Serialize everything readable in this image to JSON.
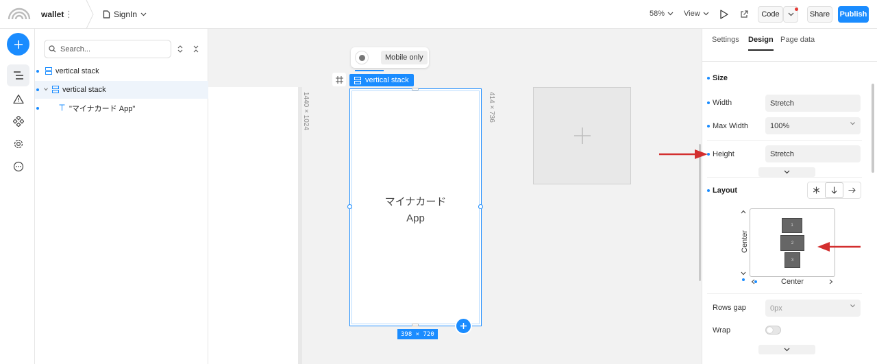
{
  "topbar": {
    "project_name": "wallet",
    "project_menu": "⋮",
    "page_name": "SignIn",
    "zoom": "58%",
    "view_label": "View",
    "code_label": "Code",
    "share_label": "Share",
    "publish_label": "Publish"
  },
  "rail": {
    "items": [
      "add-icon",
      "layers-icon",
      "warning-icon",
      "components-icon",
      "settings-icon",
      "more-icon"
    ]
  },
  "layers_panel": {
    "search_placeholder": "Search...",
    "rows": [
      {
        "label": "vertical stack",
        "type": "stack-icon",
        "selected": false
      },
      {
        "label": "vertical stack",
        "type": "stack-icon",
        "selected": true
      },
      {
        "label": "\"マイナカード App\"",
        "type": "text-icon",
        "selected": false
      }
    ]
  },
  "canvas": {
    "desktop_size": "1440 × 1024",
    "mobile_size": "414 × 736",
    "mobile_only_label": "Mobile only",
    "selection_tag": "vertical stack",
    "phone_text_line1": "マイナカード",
    "phone_text_line2": "App",
    "selection_size": "398 × 720"
  },
  "right_panel": {
    "tabs": [
      "Settings",
      "Design",
      "Page data"
    ],
    "active_tab": "Design",
    "size_section": {
      "title": "Size",
      "width_label": "Width",
      "width_value": "Stretch",
      "max_width_label": "Max Width",
      "max_width_value": "100%",
      "height_label": "Height",
      "height_value": "Stretch"
    },
    "layout_section": {
      "title": "Layout",
      "items": [
        "1",
        "2",
        "3"
      ],
      "horizontal_align": "Center",
      "vertical_align": "Center",
      "rows_gap_label": "Rows gap",
      "rows_gap_value": "0px",
      "wrap_label": "Wrap",
      "wrap_on": false
    }
  },
  "colors": {
    "accent": "#1a8cff",
    "annotation_arrow": "#d32f2f"
  }
}
